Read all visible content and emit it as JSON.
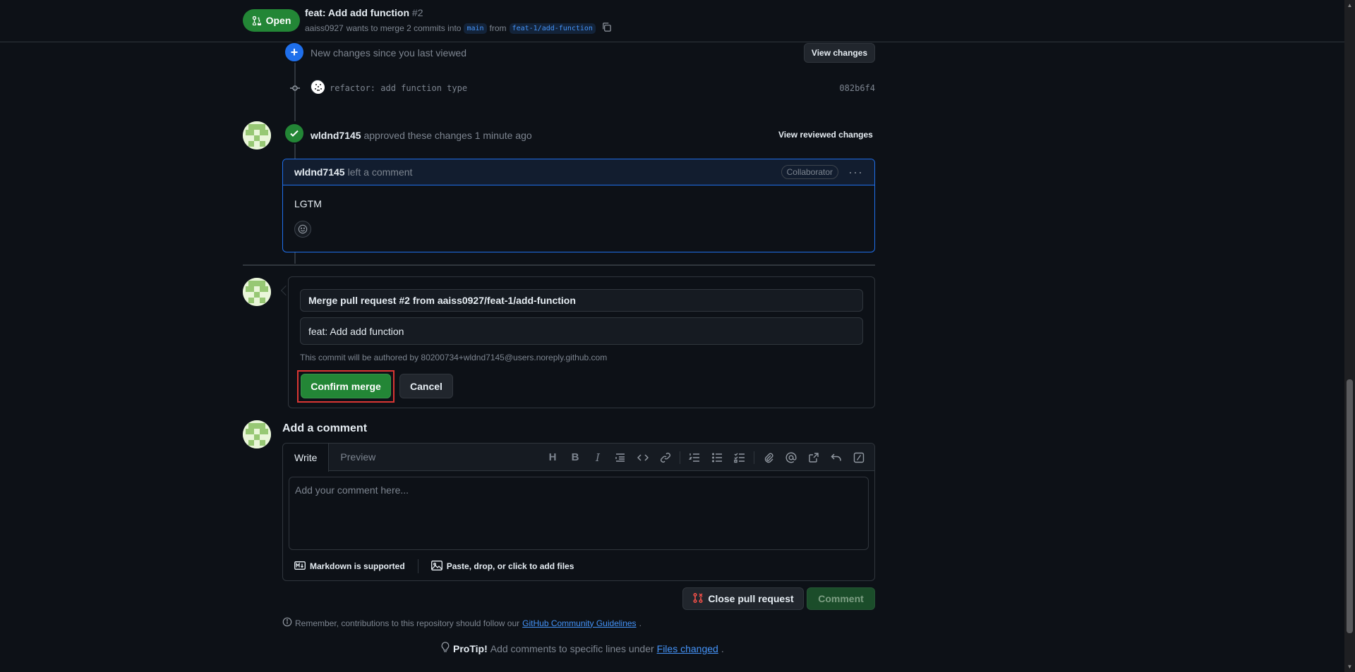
{
  "header": {
    "state": "Open",
    "title": "feat: Add add function",
    "number": "#2",
    "author": "aaiss0927",
    "merge_text": "wants to merge 2 commits into",
    "base_branch": "main",
    "from_text": "from",
    "head_branch": "feat-1/add-function"
  },
  "timeline": {
    "new_changes": "New changes since you last viewed",
    "view_changes": "View changes",
    "commit_message": "refactor: add function type",
    "commit_sha": "082b6f4",
    "review_user": "wldnd7145",
    "review_text": "approved these changes 1 minute ago",
    "view_reviewed": "View reviewed changes",
    "comment_user": "wldnd7145",
    "comment_action": "left a comment",
    "comment_badge": "Collaborator",
    "comment_body": "LGTM"
  },
  "merge": {
    "commit_title": "Merge pull request #2 from aaiss0927/feat-1/add-function",
    "commit_body": "feat: Add add function",
    "author_note": "This commit will be authored by 80200734+wldnd7145@users.noreply.github.com",
    "confirm_label": "Confirm merge",
    "cancel_label": "Cancel"
  },
  "comment": {
    "heading": "Add a comment",
    "tab_write": "Write",
    "tab_preview": "Preview",
    "placeholder": "Add your comment here...",
    "markdown_note": "Markdown is supported",
    "attach_note": "Paste, drop, or click to add files",
    "close_label": "Close pull request",
    "comment_label": "Comment"
  },
  "footer": {
    "remember_text": "Remember, contributions to this repository should follow our",
    "guidelines_link": "GitHub Community Guidelines",
    "remember_end": ".",
    "protip_label": "ProTip!",
    "protip_text": "Add comments to specific lines under",
    "files_link": "Files changed",
    "protip_end": "."
  },
  "toolbar_icons": [
    "heading-icon",
    "bold-icon",
    "italic-icon",
    "quote-icon",
    "code-icon",
    "link-icon",
    "numbered-list-icon",
    "bulleted-list-icon",
    "task-list-icon",
    "attach-icon",
    "mention-icon",
    "reference-icon",
    "undo-icon",
    "slash-commands-icon"
  ],
  "colors": {
    "accent_green": "#238636",
    "accent_blue": "#1f6feb",
    "danger": "#da3633"
  }
}
